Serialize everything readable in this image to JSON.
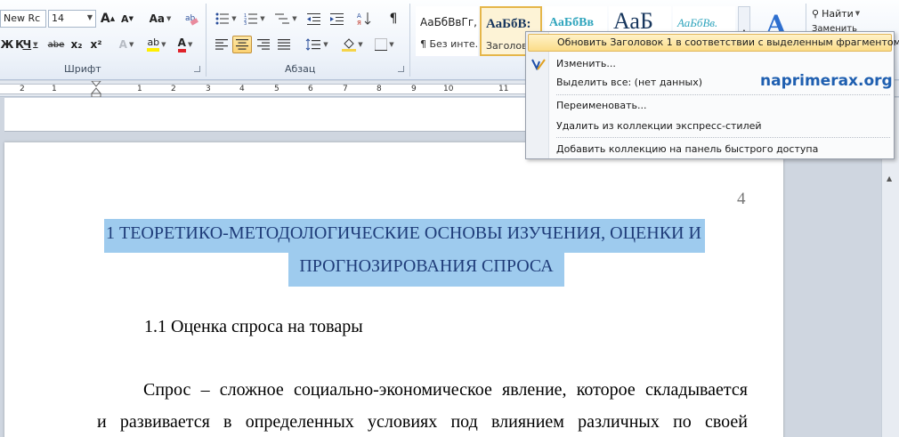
{
  "ribbon": {
    "font_name": "New Rc",
    "font_size": "14",
    "btn_grow": "A",
    "btn_shrink": "A",
    "btn_case": "Aa",
    "btn_bold": "Ж",
    "btn_italic": "К",
    "btn_underline": "Ч",
    "btn_strike": "abe",
    "btn_sub": "x₂",
    "btn_sup": "x²",
    "btn_highlight": "ab",
    "btn_fontcolor": "A",
    "btn_pilcrow": "¶",
    "group_font": "Шрифт",
    "group_paragraph": "Абзац",
    "find_label": "Найти",
    "replace_label": "Заменить"
  },
  "styles": [
    {
      "sample": "АаБбВвГг,",
      "name": "¶ Без инте..."
    },
    {
      "sample": "АаБбВ:",
      "name": "Заголовок"
    },
    {
      "sample": "АаБбВв",
      "name": ""
    },
    {
      "sample": "АаБ",
      "name": ""
    },
    {
      "sample": "АаБбВв.",
      "name": ""
    }
  ],
  "ruler": {
    "numbers": [
      "2",
      "1",
      "1",
      "2",
      "3",
      "4",
      "5",
      "6",
      "7",
      "8",
      "9",
      "10",
      "11"
    ]
  },
  "menu": {
    "item_update": "Обновить Заголовок 1 в соответствии с выделенным фрагментом",
    "item_modify": "Изменить...",
    "item_select_all": "Выделить все: (нет данных)",
    "item_rename": "Переименовать...",
    "item_remove": "Удалить из коллекции экспресс-стилей",
    "item_add_qat": "Добавить коллекцию на панель быстрого доступа",
    "watermark": "naprimerax.org"
  },
  "document": {
    "page_number": "4",
    "heading_line1": "1 ТЕОРЕТИКО-МЕТОДОЛОГИЧЕСКИЕ ОСНОВЫ ИЗУЧЕНИЯ, ОЦЕНКИ И",
    "heading_line2": "ПРОГНОЗИРОВАНИЯ СПРОСА",
    "subheading": "1.1 Оценка спроса на товары",
    "para_line1": "Спрос – сложное социально-экономическое явление, которое складывается",
    "para_line2": "и развивается в определенных условиях под влиянием различных по своей"
  },
  "colors": {
    "selection": "#9ecbee",
    "heading_text": "#1f3c79",
    "menu_hover": "#fbdc88",
    "watermark": "#1f5fb0"
  }
}
